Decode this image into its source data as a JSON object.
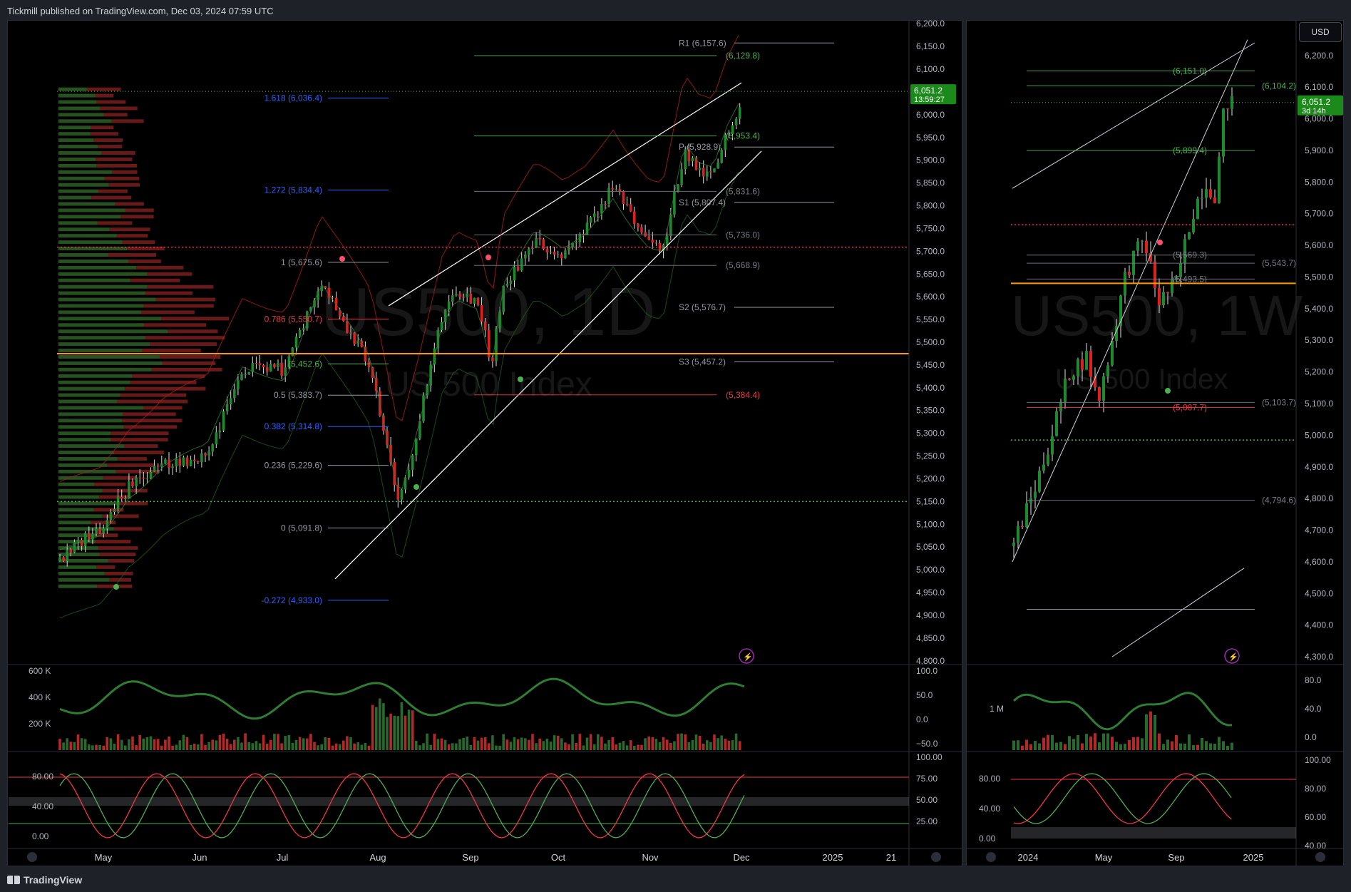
{
  "header": {
    "publisher_line": "Tickmill published on TradingView.com, Dec 03, 2024 07:59 UTC"
  },
  "footer": {
    "brand": "TradingView"
  },
  "currency_button": "USD",
  "chart_data": [
    {
      "type": "candlestick",
      "symbol_watermark": "US500, 1D",
      "description_watermark": "US 500 Index",
      "price_axis": [
        "6,200.0",
        "6,150.0",
        "6,100.0",
        "6,050.0",
        "6,000.0",
        "5,950.0",
        "5,900.0",
        "5,850.0",
        "5,800.0",
        "5,750.0",
        "5,700.0",
        "5,650.0",
        "5,600.0",
        "5,550.0",
        "5,500.0",
        "5,450.0",
        "5,400.0",
        "5,350.0",
        "5,300.0",
        "5,250.0",
        "5,200.0",
        "5,150.0",
        "5,100.0",
        "5,050.0",
        "5,000.0",
        "4,950.0",
        "4,900.0",
        "4,850.0",
        "4,800.0"
      ],
      "ylim": [
        4795,
        6205
      ],
      "time_axis": [
        "May",
        "Jun",
        "Jul",
        "Aug",
        "Sep",
        "Oct",
        "Nov",
        "Dec",
        "2025",
        "21"
      ],
      "last_price": {
        "value": "6,051.2",
        "countdown": "13:59:27",
        "price": 6051.2
      },
      "fib_levels": [
        {
          "label": "1.618 (6,036.4)",
          "price": 6036.4,
          "color": "#2962ff"
        },
        {
          "label": "1.272 (5,834.4)",
          "price": 5834.4,
          "color": "#2962ff"
        },
        {
          "label": "1 (5,675.6)",
          "price": 5675.6,
          "color": "#9598a1"
        },
        {
          "label": "0.786 (5,550.7)",
          "price": 5550.7,
          "color": "#f23645"
        },
        {
          "label": "(5,452.6)",
          "price": 5452.6,
          "color": "#4caf50"
        },
        {
          "label": "0.5 (5,383.7)",
          "price": 5383.7,
          "color": "#9598a1"
        },
        {
          "label": "0.382 (5,314.8)",
          "price": 5314.8,
          "color": "#2962ff"
        },
        {
          "label": "0.236 (5,229.6)",
          "price": 5229.6,
          "color": "#9598a1"
        },
        {
          "label": "0 (5,091.8)",
          "price": 5091.8,
          "color": "#9598a1"
        },
        {
          "label": "-0.272 (4,933.0)",
          "price": 4933.0,
          "color": "#2962ff"
        }
      ],
      "pivot_levels": [
        {
          "label": "R1 (6,157.6)",
          "price": 6157.6
        },
        {
          "label": "P (5,928.9)",
          "price": 5928.9
        },
        {
          "label": "S1 (5,807.4)",
          "price": 5807.4
        },
        {
          "label": "S2 (5,576.7)",
          "price": 5576.7
        },
        {
          "label": "S3 (5,457.2)",
          "price": 5457.2
        }
      ],
      "other_levels": [
        {
          "label": "(6,129.8)",
          "price": 6129.8,
          "color": "#4caf50"
        },
        {
          "label": "(5,953.4)",
          "price": 5953.4,
          "color": "#4caf50"
        },
        {
          "label": "(5,831.6)",
          "price": 5831.6,
          "color": "#787b86"
        },
        {
          "label": "(5,736.0)",
          "price": 5736.0,
          "color": "#787b86"
        },
        {
          "label": "(5,668.9)",
          "price": 5668.9,
          "color": "#787b86"
        },
        {
          "label": "(5,384.4)",
          "price": 5384.4,
          "color": "#f23645"
        }
      ],
      "orange_line": 5475,
      "red_dotted_line": 5709,
      "green_dotted_line": 5150,
      "volume_axis": [
        "600 K",
        "400 K",
        "200 K"
      ],
      "oscillator_axis": [
        "100.0",
        "50.0",
        "0.0",
        "−50.0"
      ],
      "stoch_axis_left": [
        "80.00",
        "40.00",
        "0.00"
      ],
      "stoch_axis_right": [
        "100.00",
        "75.00",
        "50.00",
        "25.00"
      ]
    },
    {
      "type": "candlestick",
      "symbol_watermark": "US500, 1W",
      "description_watermark": "US 500 Index",
      "price_axis": [
        "6,200.0",
        "6,100.0",
        "6,000.0",
        "5,900.0",
        "5,800.0",
        "5,700.0",
        "5,600.0",
        "5,500.0",
        "5,400.0",
        "5,300.0",
        "5,200.0",
        "5,100.0",
        "5,000.0",
        "4,900.0",
        "4,800.0",
        "4,700.0",
        "4,600.0",
        "4,500.0",
        "4,400.0",
        "4,300.0"
      ],
      "ylim": [
        4280,
        6240
      ],
      "time_axis": [
        "2024",
        "May",
        "Sep",
        "2025"
      ],
      "last_price": {
        "value": "6,051.2",
        "countdown": "3d 14h",
        "price": 6051.2
      },
      "levels": [
        {
          "label": "(6,151.0)",
          "price": 6151.0,
          "color": "#4caf50"
        },
        {
          "label": "(6,104.2)",
          "price": 6104.2,
          "color": "#4caf50"
        },
        {
          "label": "(5,899.4)",
          "price": 5899.4,
          "color": "#4caf50"
        },
        {
          "label": "(5,569.3)",
          "price": 5569.3,
          "color": "#787b86"
        },
        {
          "label": "(5,543.7)",
          "price": 5543.7,
          "color": "#787b86"
        },
        {
          "label": "(5,493.5)",
          "price": 5493.5,
          "color": "#787b86"
        },
        {
          "label": "(5,103.7)",
          "price": 5103.7,
          "color": "#787b86"
        },
        {
          "label": "(5,087.7)",
          "price": 5087.7,
          "color": "#f23645"
        },
        {
          "label": "(4,794.6)",
          "price": 4794.6,
          "color": "#787b86"
        }
      ],
      "volume_axis": [
        "1 M"
      ],
      "oscillator_axis": [
        "80.0",
        "40.0",
        "0.0"
      ],
      "stoch_axis_left": [
        "80.00",
        "40.00",
        "0.00"
      ],
      "stoch_axis_right": [
        "100.00",
        "80.00",
        "60.00",
        "40.00"
      ]
    }
  ]
}
